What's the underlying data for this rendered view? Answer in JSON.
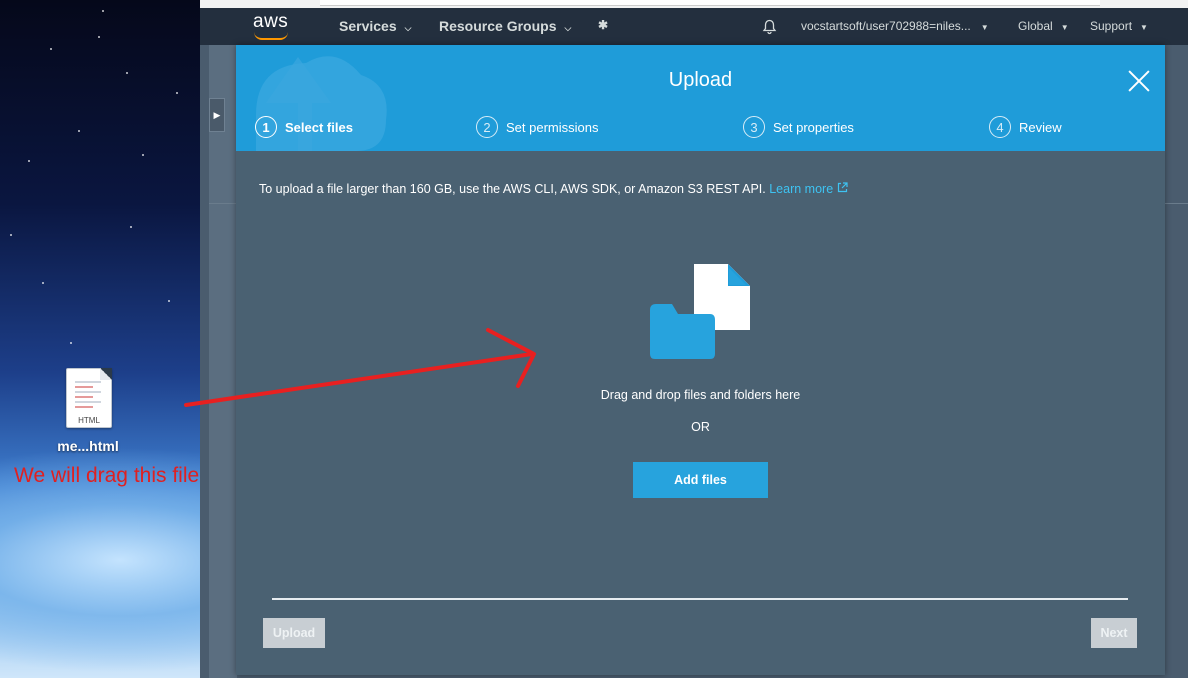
{
  "desktop": {
    "file_name": "me...html",
    "file_type": "HTML",
    "drag_note": "We will drag this file"
  },
  "navbar": {
    "logo": "aws",
    "services": "Services",
    "resource_groups": "Resource Groups",
    "account": "vocstartsoft/user702988=niles...",
    "region": "Global",
    "support": "Support"
  },
  "modal": {
    "title": "Upload",
    "steps": [
      {
        "num": "1",
        "label": "Select files"
      },
      {
        "num": "2",
        "label": "Set permissions"
      },
      {
        "num": "3",
        "label": "Set properties"
      },
      {
        "num": "4",
        "label": "Review"
      }
    ],
    "active_step": 1,
    "info_text": "To upload a file larger than 160 GB, use the AWS CLI, AWS SDK, or Amazon S3 REST API.",
    "learn_more": "Learn more",
    "drop_text": "Drag and drop files and folders here",
    "or_text": "OR",
    "add_files": "Add files",
    "upload_button": "Upload",
    "next_button": "Next"
  },
  "colors": {
    "header_blue": "#1f9cd9",
    "modal_body": "#4a6172",
    "button_blue": "#27a3dd",
    "arrow_red": "#e02020",
    "aws_orange": "#ff9900"
  }
}
